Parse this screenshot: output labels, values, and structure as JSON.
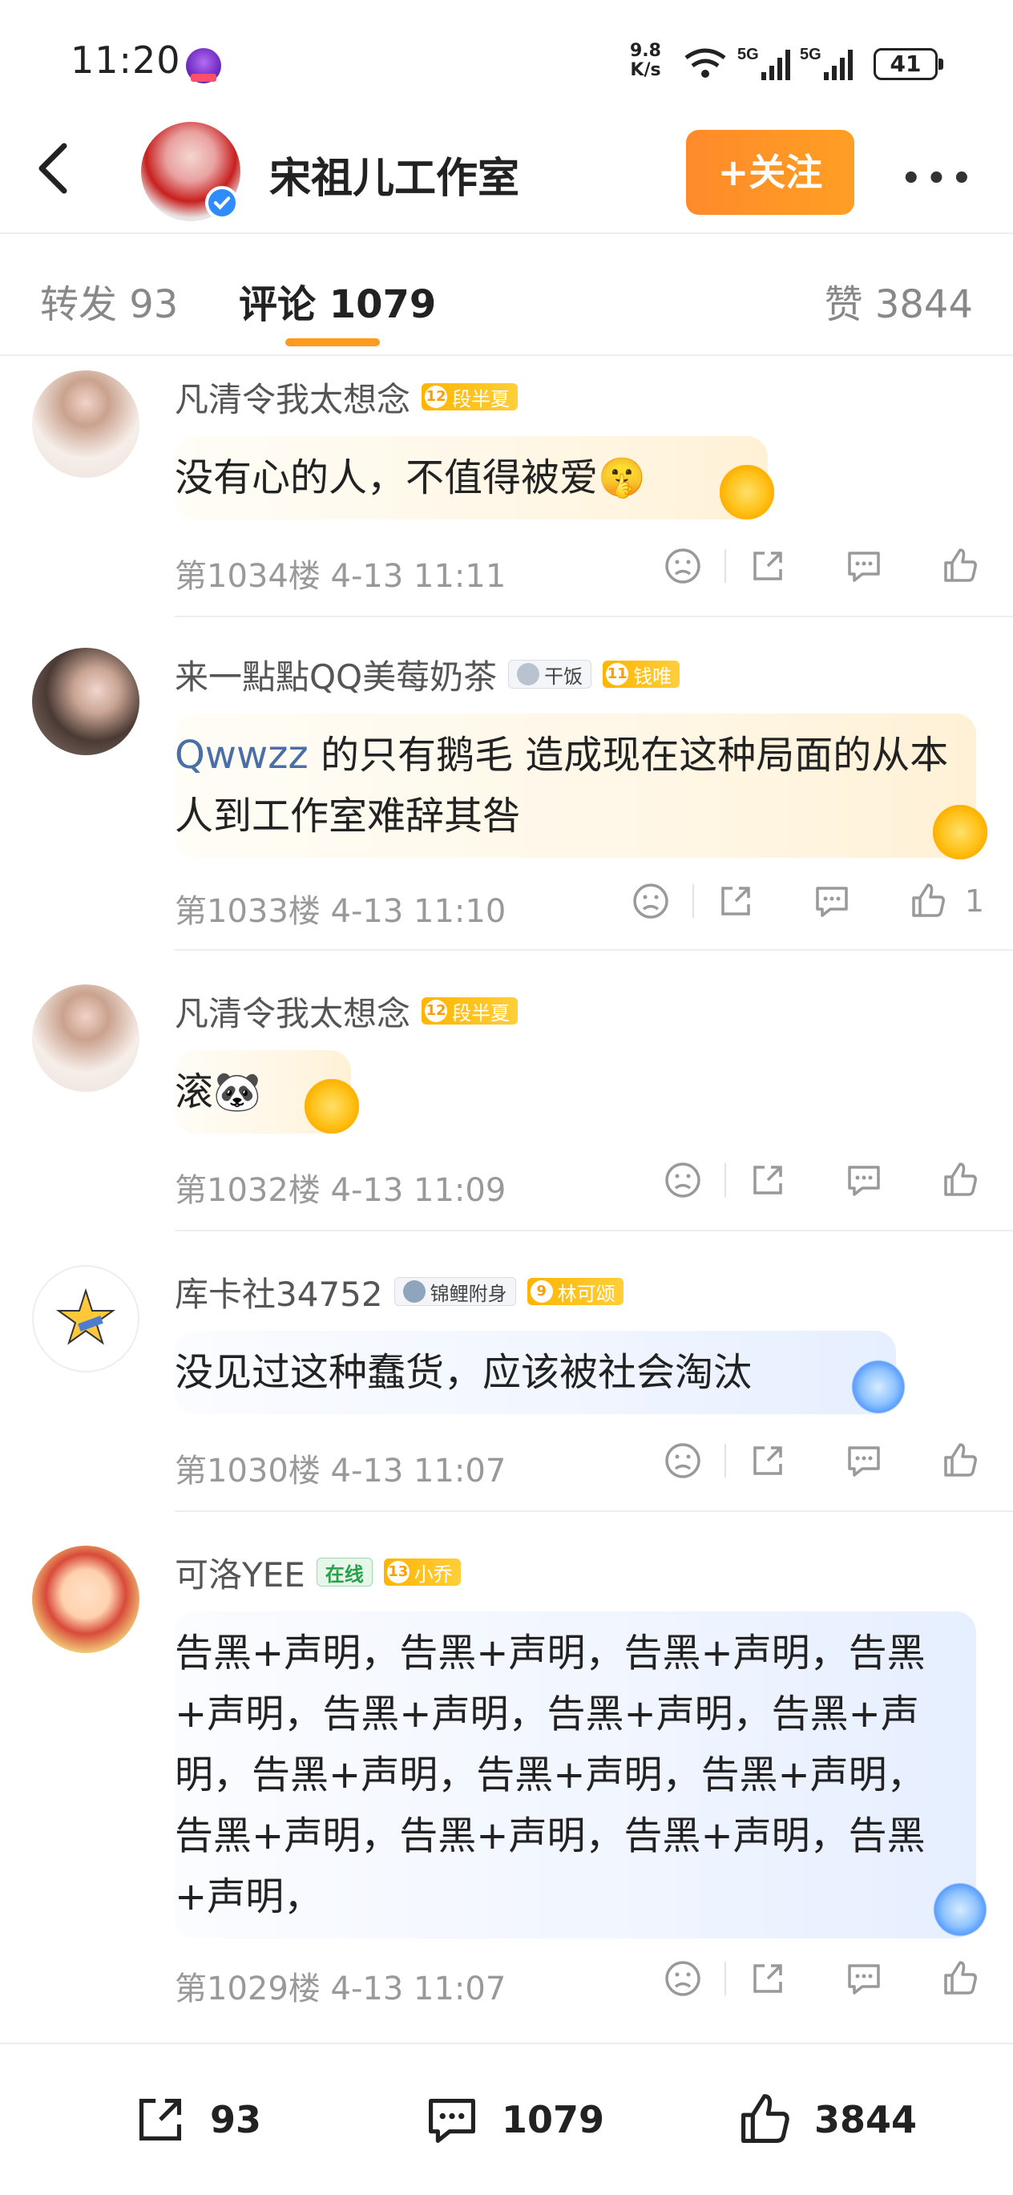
{
  "status_bar": {
    "time": "11:20",
    "net_speed_value": "9.8",
    "net_speed_unit": "K/s",
    "sim1_label": "5G",
    "sim2_label": "5G",
    "battery": "41"
  },
  "header": {
    "title": "宋祖儿工作室",
    "follow_label": "+关注"
  },
  "tabs": {
    "repost": "转发 93",
    "comments": "评论 1079",
    "likes": "赞 3844"
  },
  "comments": [
    {
      "name": "凡清令我太想念",
      "badges": [
        {
          "level": "12",
          "text": "段半夏",
          "style": "gold"
        }
      ],
      "text": "没有心的人，不值得被爱🤫",
      "meta": "第1034楼 4-13 11:11",
      "like_count": ""
    },
    {
      "name": "来一點點QQ美莓奶茶",
      "badges": [
        {
          "text": "干饭",
          "style": "plain"
        },
        {
          "level": "11",
          "text": "钱唯",
          "style": "gold"
        }
      ],
      "mention": "Qwwzz",
      "text": " 的只有鹅毛 造成现在这种局面的从本人到工作室难辞其咎",
      "meta": "第1033楼 4-13 11:10",
      "like_count": "1"
    },
    {
      "name": "凡清令我太想念",
      "badges": [
        {
          "level": "12",
          "text": "段半夏",
          "style": "gold"
        }
      ],
      "text": "滚🐼",
      "meta": "第1032楼 4-13 11:09",
      "like_count": ""
    },
    {
      "name": "库卡社34752",
      "badges": [
        {
          "text": "锦鲤附身",
          "style": "plain"
        },
        {
          "level": "9",
          "text": "林可颂",
          "style": "gold"
        }
      ],
      "text": "没见过这种蠢货，应该被社会淘汰",
      "meta": "第1030楼 4-13 11:07",
      "like_count": ""
    },
    {
      "name": "可洛YEE",
      "badges": [
        {
          "text": "在线",
          "style": "green"
        },
        {
          "level": "13",
          "text": "小乔",
          "style": "gold"
        }
      ],
      "text": "告黑+声明，告黑+声明，告黑+声明，告黑+声明，告黑+声明，告黑+声明，告黑+声明，告黑+声明，告黑+声明，告黑+声明，告黑+声明，告黑+声明，告黑+声明，告黑+声明，",
      "meta": "第1029楼 4-13 11:07",
      "like_count": ""
    }
  ],
  "bottom_bar": {
    "repost_count": "93",
    "comment_count": "1079",
    "like_count": "3844"
  },
  "colors": {
    "accent_orange": "#ff9a1f",
    "mention_blue": "#4a6fa8",
    "muted_text": "#999999"
  }
}
